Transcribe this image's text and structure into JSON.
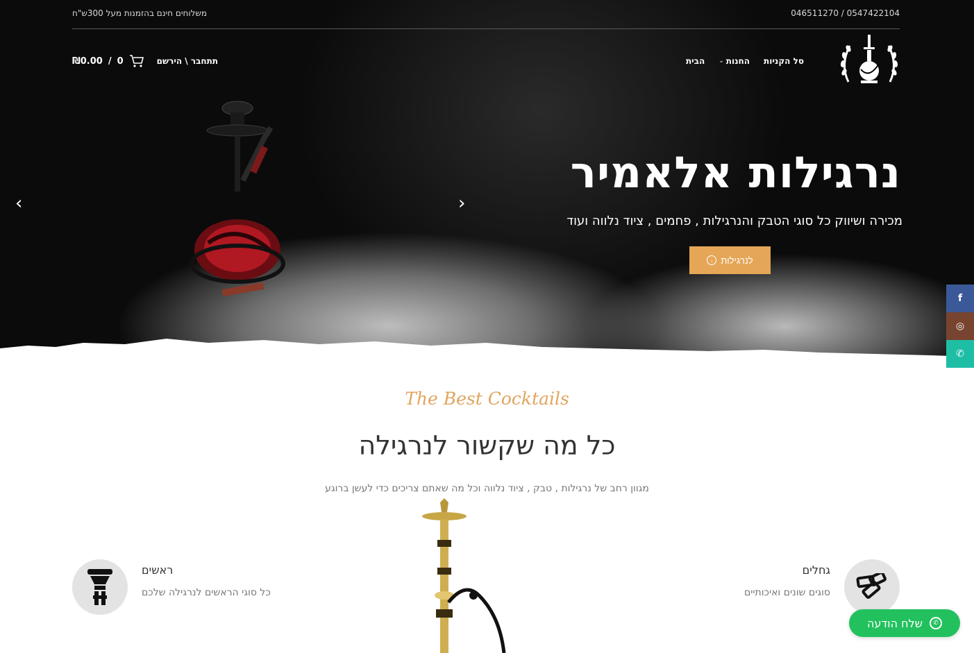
{
  "topbar": {
    "phones": "046511270 / 0547422104",
    "shipping": "משלוחים חינם בהזמנות מעל 300ש\"ח"
  },
  "nav": {
    "home": "הבית",
    "shop": "החנות",
    "cart": "סל הקניות"
  },
  "header": {
    "login": "תתחבר \\ הירשם",
    "cart_count": "0",
    "cart_total": "₪0.00",
    "cart_sep": "/"
  },
  "hero": {
    "title": "נרגילות אלאמיר",
    "subtitle": "מכירה ושיווק כל סוגי הטבק והנרגילות , פחמים , ציוד נלווה ועוד",
    "button": "לנרגילות",
    "prev_arrow": "‹",
    "next_arrow": "›"
  },
  "social": {
    "facebook": "f",
    "instagram": "◎",
    "whatsapp": "✆"
  },
  "section": {
    "script": "The Best Cocktails",
    "title": "כל מה שקשור לנרגילה",
    "subtitle": "מגוון רחב של נרגילות , טבק , ציוד נלווה וכל מה שאתם צריכים כדי לעשן ברוגע"
  },
  "features": [
    {
      "title": "גחלים",
      "text": "סוגים שונים ואיכותיים",
      "icon": "coals-icon"
    },
    {
      "title": "ראשים",
      "text": "כל סוגי הראשים לנרגילה שלכם",
      "icon": "hookah-bowl-icon"
    }
  ],
  "whatsapp_button": {
    "label": "שלח הודעה"
  },
  "colors": {
    "accent": "#e5a657",
    "whatsapp": "#22c15e",
    "facebook": "#3b5998",
    "instagram": "#774430",
    "whatsapp_side": "#1ebea5"
  }
}
